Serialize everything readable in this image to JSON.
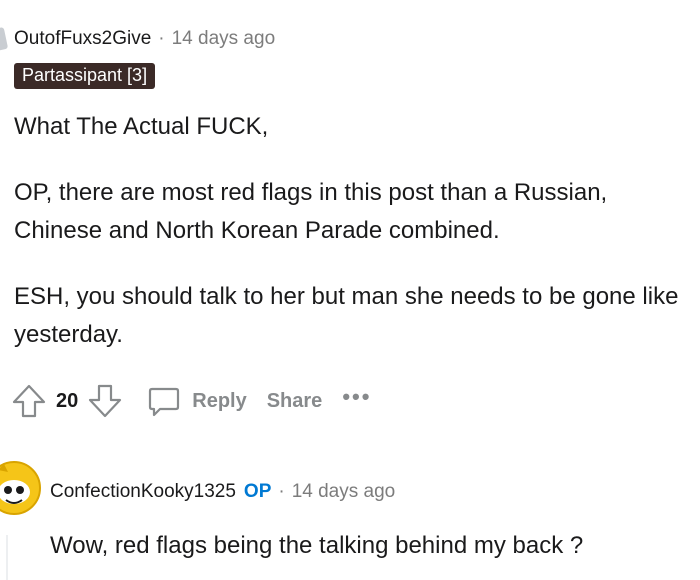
{
  "comment": {
    "author": "OutofFuxs2Give",
    "separator": "·",
    "time": "14 days ago",
    "flair": "Partassipant [3]",
    "paragraphs": [
      "What The Actual FUCK,",
      "OP, there are most red flags in this post than a Russian, Chinese and North Korean Parade combined.",
      "ESH, you should talk to her but man she needs to be gone like yesterday."
    ],
    "score": "20",
    "reply_label": "Reply",
    "share_label": "Share",
    "more_label": "•••",
    "icons": {
      "upvote": "upvote-arrow-icon",
      "downvote": "downvote-arrow-icon",
      "reply": "speech-bubble-icon",
      "avatar_color": "#f5c518"
    }
  },
  "reply": {
    "author": "ConfectionKooky1325",
    "op_badge": "OP",
    "separator": "·",
    "time": "14 days ago",
    "text": "Wow, red flags being the talking behind my back ?"
  }
}
